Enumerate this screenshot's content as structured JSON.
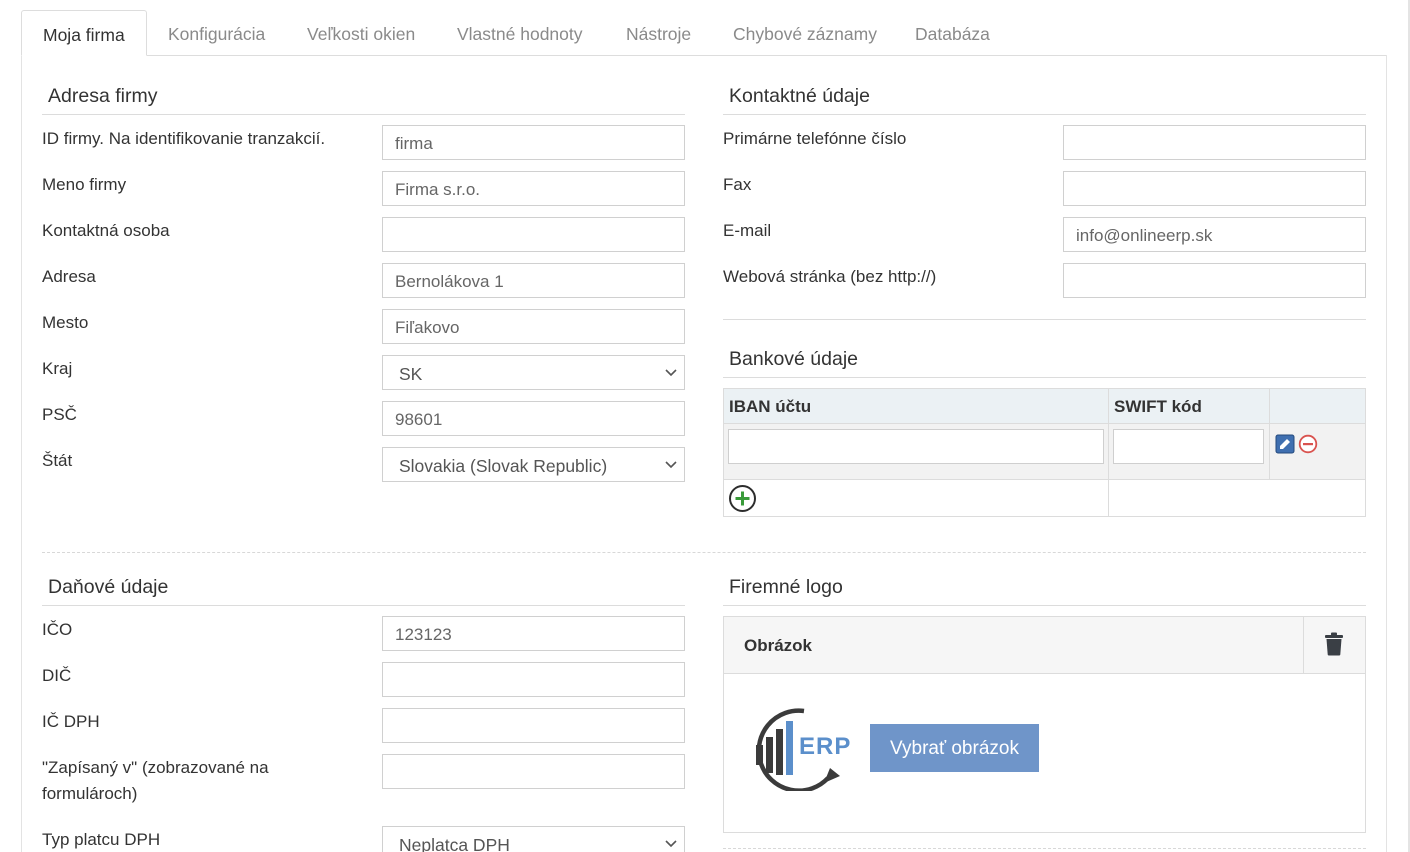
{
  "tabs": [
    {
      "label": "Moja firma",
      "active": true
    },
    {
      "label": "Konfigurácia",
      "active": false
    },
    {
      "label": "Veľkosti okien",
      "active": false
    },
    {
      "label": "Vlastné hodnoty",
      "active": false
    },
    {
      "label": "Nástroje",
      "active": false
    },
    {
      "label": "Chybové záznamy",
      "active": false
    },
    {
      "label": "Databáza",
      "active": false
    }
  ],
  "company_address": {
    "title": "Adresa firmy",
    "fields": [
      {
        "label": "ID firmy. Na identifikovanie tranzakcií.",
        "value": "firma"
      },
      {
        "label": "Meno firmy",
        "value": "Firma s.r.o."
      },
      {
        "label": "Kontaktná osoba",
        "value": ""
      },
      {
        "label": "Adresa",
        "value": "Bernolákova 1"
      },
      {
        "label": "Mesto",
        "value": "Fiľakovo"
      },
      {
        "label": "Kraj",
        "value": "SK"
      },
      {
        "label": "PSČ",
        "value": "98601"
      },
      {
        "label": "Štát",
        "value": "Slovakia (Slovak Republic)"
      }
    ]
  },
  "contact": {
    "title": "Kontaktné údaje",
    "fields": [
      {
        "label": "Primárne telefónne číslo",
        "value": ""
      },
      {
        "label": "Fax",
        "value": ""
      },
      {
        "label": "E-mail",
        "value": "info@onlineerp.sk"
      },
      {
        "label": "Webová stránka (bez http://)",
        "value": ""
      }
    ]
  },
  "bank": {
    "title": "Bankové údaje",
    "col_iban": "IBAN účtu",
    "col_swift": "SWIFT kód",
    "rows": [
      {
        "iban": "",
        "swift": ""
      }
    ]
  },
  "tax": {
    "title": "Daňové údaje",
    "fields": [
      {
        "label": "IČO",
        "value": "123123"
      },
      {
        "label": "DIČ",
        "value": ""
      },
      {
        "label": "IČ DPH",
        "value": ""
      },
      {
        "label": "\"Zapísaný v\" (zobrazované na formulároch)",
        "value": ""
      },
      {
        "label": "Typ platcu DPH",
        "value": "Neplatca DPH"
      }
    ]
  },
  "logo": {
    "title": "Firemné logo",
    "image_header": "Obrázok",
    "logo_text": "ERP",
    "pick_button": "Vybrať obrázok"
  },
  "colors": {
    "accent_button": "#6f95c9",
    "add_icon": "#3a9b3a",
    "remove_icon": "#d9534f",
    "table_header_bg": "#ebf1f4"
  },
  "icons": {
    "edit": "edit-icon",
    "remove": "remove-row-icon",
    "add": "add-row-icon",
    "delete": "trash-icon",
    "select": "chevron-down-icon"
  }
}
